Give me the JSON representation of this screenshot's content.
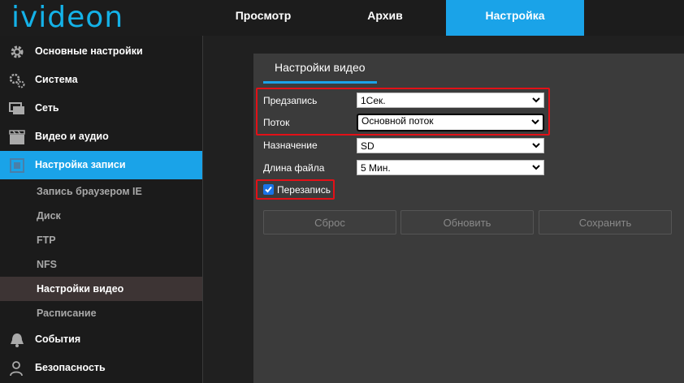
{
  "logo": "ivideon",
  "colors": {
    "accent": "#1aa3e8",
    "highlight_box": "#e31017"
  },
  "tabs": [
    {
      "label": "Просмотр",
      "active": false
    },
    {
      "label": "Архив",
      "active": false
    },
    {
      "label": "Настройка",
      "active": true
    }
  ],
  "sidebar": {
    "items": [
      {
        "label": "Основные настройки",
        "icon": "gear-icon"
      },
      {
        "label": "Система",
        "icon": "gears-icon"
      },
      {
        "label": "Сеть",
        "icon": "network-icon"
      },
      {
        "label": "Видео и аудио",
        "icon": "clapperboard-icon"
      },
      {
        "label": "Настройка записи",
        "icon": "record-settings-icon",
        "active": true
      },
      {
        "label": "События",
        "icon": "bell-icon"
      },
      {
        "label": "Безопасность",
        "icon": "user-icon"
      }
    ],
    "subitems": [
      {
        "label": "Запись браузером IE"
      },
      {
        "label": "Диск"
      },
      {
        "label": "FTP"
      },
      {
        "label": "NFS"
      },
      {
        "label": "Настройки видео",
        "active": true
      },
      {
        "label": "Расписание"
      }
    ]
  },
  "panel": {
    "title": "Настройки видео",
    "fields": [
      {
        "label": "Предзапись",
        "value": "1Сек."
      },
      {
        "label": "Поток",
        "value": "Основной поток"
      },
      {
        "label": "Назначение",
        "value": "SD"
      },
      {
        "label": "Длина файла",
        "value": "5 Мин."
      }
    ],
    "overwrite": {
      "label": "Перезапись",
      "checked": true
    },
    "buttons": {
      "reset": "Сброс",
      "refresh": "Обновить",
      "save": "Сохранить"
    }
  }
}
